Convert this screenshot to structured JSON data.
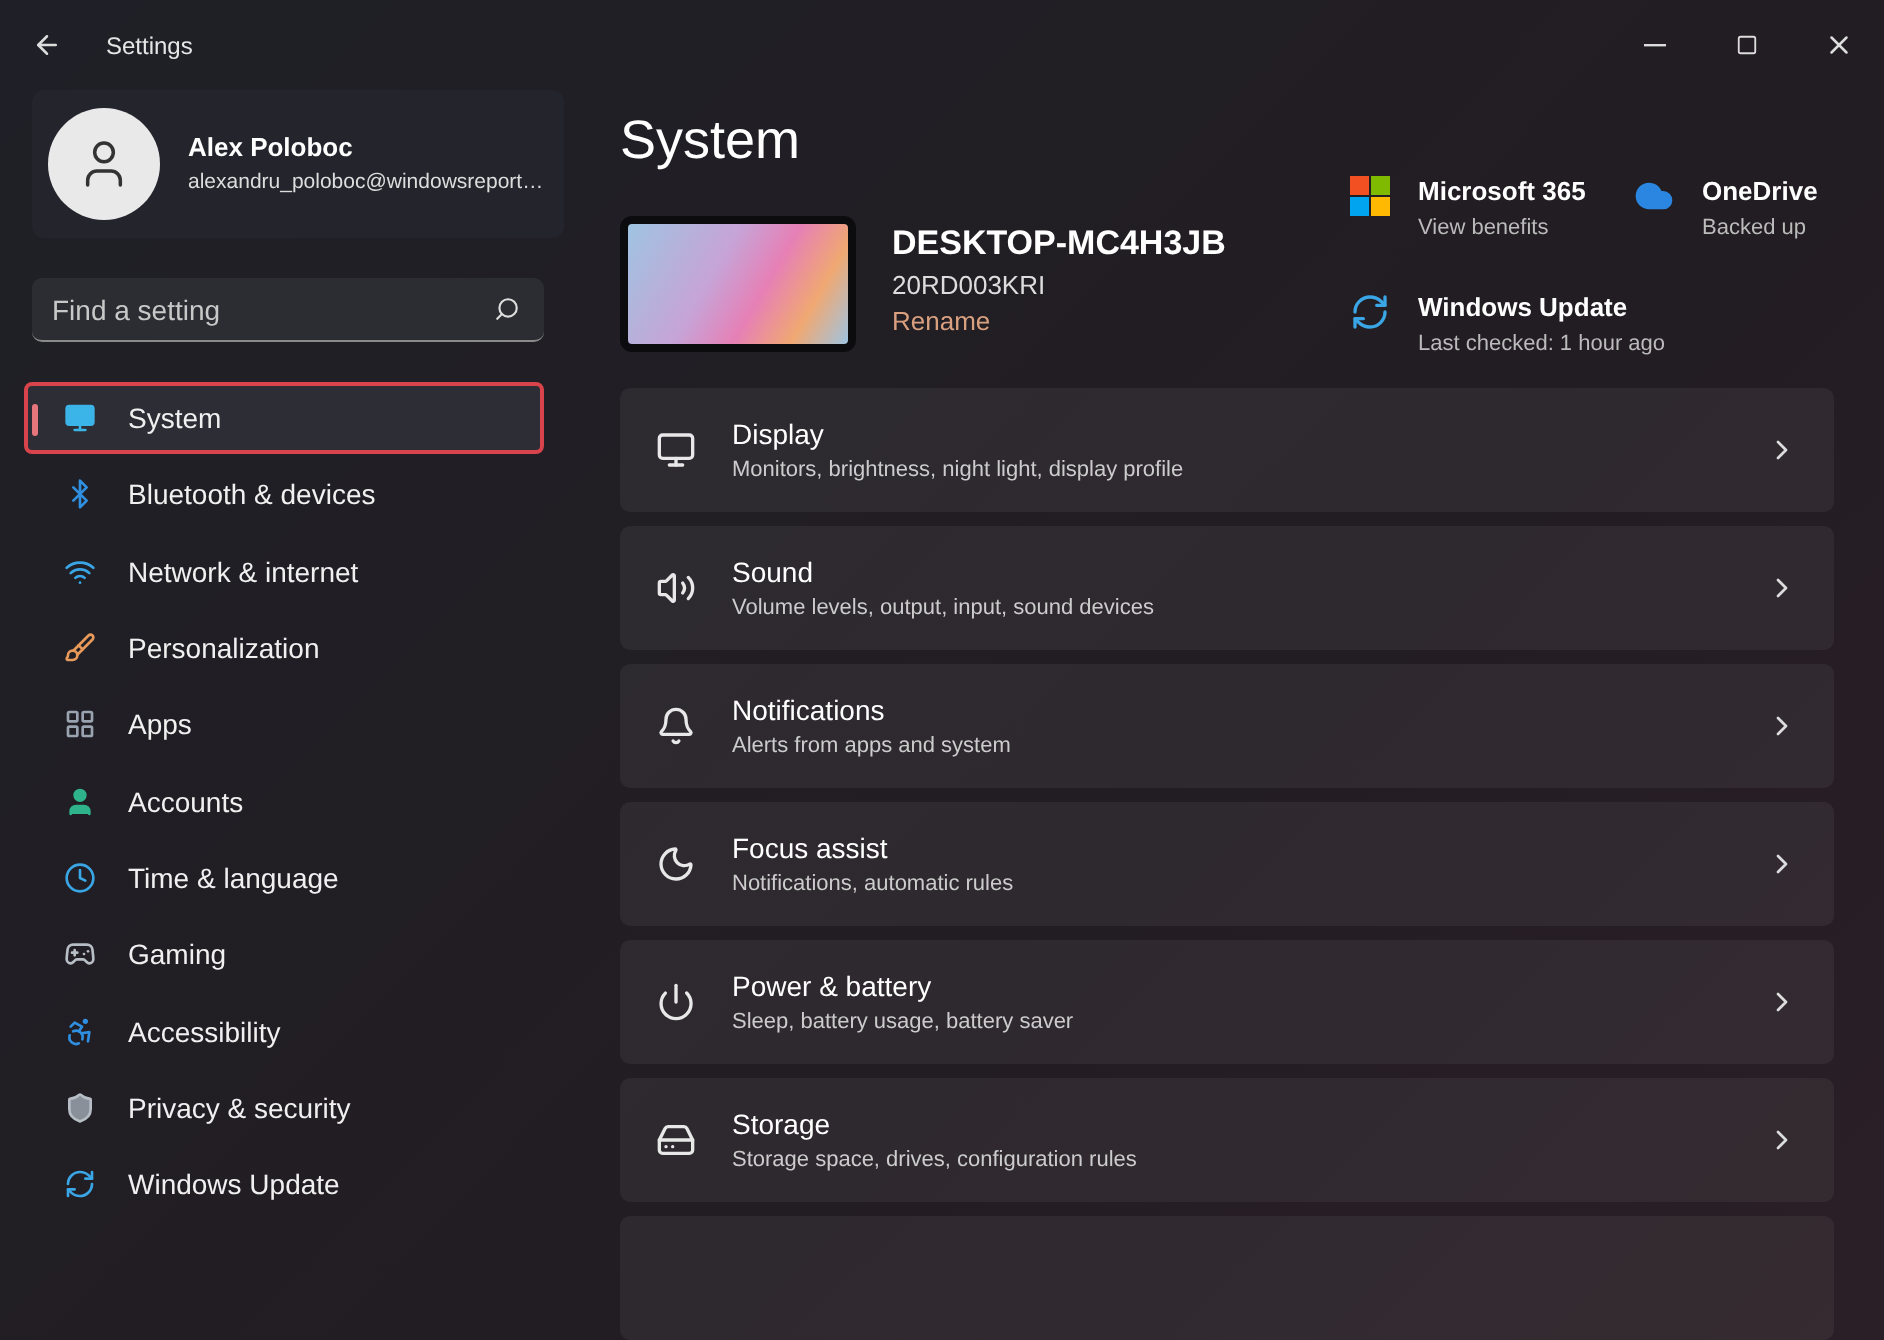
{
  "window": {
    "title": "Settings"
  },
  "account": {
    "name": "Alex Poloboc",
    "email": "alexandru_poloboc@windowsreport…"
  },
  "search": {
    "placeholder": "Find a setting"
  },
  "sidebar": {
    "items": [
      {
        "label": "System",
        "kind": "system",
        "selected": true
      },
      {
        "label": "Bluetooth & devices",
        "kind": "bluetooth",
        "selected": false
      },
      {
        "label": "Network & internet",
        "kind": "network",
        "selected": false
      },
      {
        "label": "Personalization",
        "kind": "brush",
        "selected": false
      },
      {
        "label": "Apps",
        "kind": "apps",
        "selected": false
      },
      {
        "label": "Accounts",
        "kind": "accounts",
        "selected": false
      },
      {
        "label": "Time & language",
        "kind": "time",
        "selected": false
      },
      {
        "label": "Gaming",
        "kind": "gaming",
        "selected": false
      },
      {
        "label": "Accessibility",
        "kind": "accessibility",
        "selected": false
      },
      {
        "label": "Privacy & security",
        "kind": "privacy",
        "selected": false
      },
      {
        "label": "Windows Update",
        "kind": "update",
        "selected": false
      }
    ]
  },
  "page": {
    "title": "System"
  },
  "device": {
    "name": "DESKTOP-MC4H3JB",
    "model": "20RD003KRI",
    "rename": "Rename"
  },
  "tiles": [
    {
      "kind": "m365",
      "title": "Microsoft 365",
      "subtitle": "View benefits"
    },
    {
      "kind": "onedrive",
      "title": "OneDrive",
      "subtitle": "Backed up"
    },
    {
      "kind": "update",
      "title": "Windows Update",
      "subtitle": "Last checked: 1 hour ago"
    }
  ],
  "cards": [
    {
      "kind": "display",
      "title": "Display",
      "subtitle": "Monitors, brightness, night light, display profile"
    },
    {
      "kind": "sound",
      "title": "Sound",
      "subtitle": "Volume levels, output, input, sound devices"
    },
    {
      "kind": "notifications",
      "title": "Notifications",
      "subtitle": "Alerts from apps and system"
    },
    {
      "kind": "focus",
      "title": "Focus assist",
      "subtitle": "Notifications, automatic rules"
    },
    {
      "kind": "power",
      "title": "Power & battery",
      "subtitle": "Sleep, battery usage, battery saver"
    },
    {
      "kind": "storage",
      "title": "Storage",
      "subtitle": "Storage space, drives, configuration rules"
    }
  ]
}
